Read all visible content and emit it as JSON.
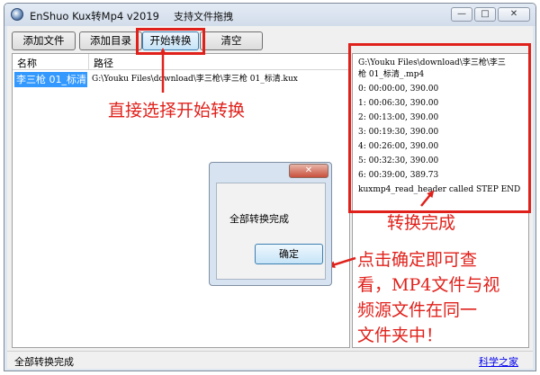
{
  "window": {
    "title": "EnShuo Kux转Mp4  v2019",
    "hint": "支持文件拖拽",
    "min_glyph": "—",
    "max_glyph": "□",
    "close_glyph": "✕"
  },
  "toolbar": {
    "add_file": "添加文件",
    "add_dir": "添加目录",
    "start": "开始转换",
    "clear": "清空"
  },
  "list": {
    "columns": [
      "名称",
      "路径"
    ],
    "rows": [
      {
        "name": "李三枪 01_标清",
        "path": "G:\\Youku Files\\download\\李三枪\\李三枪 01_标清.kux"
      }
    ]
  },
  "log": {
    "lines": [
      "G:\\Youku Files\\download\\李三枪\\李三",
      "枪 01_标清_.mp4",
      "0: 00:00:00, 390.00",
      "1: 00:06:30, 390.00",
      "2: 00:13:00, 390.00",
      "3: 00:19:30, 390.00",
      "4: 00:26:00, 390.00",
      "5: 00:32:30, 390.00",
      "6: 00:39:00, 389.73",
      "kuxmp4_read_header called  STEP END"
    ]
  },
  "dialog": {
    "message": "全部转换完成",
    "ok": "确定",
    "close_glyph": "✕"
  },
  "status": {
    "text": "全部转换完成",
    "link": "科学之家"
  },
  "annotations": {
    "start": "直接选择开始转换",
    "done": "转换完成",
    "ok_lines": [
      "点击确定即可查",
      "看，MP4文件与视",
      "频源文件在同一",
      "文件夹中！"
    ],
    "color": "#e0211b"
  },
  "colors": {
    "selection": "#3399ff",
    "highlight": "#e0211b"
  }
}
